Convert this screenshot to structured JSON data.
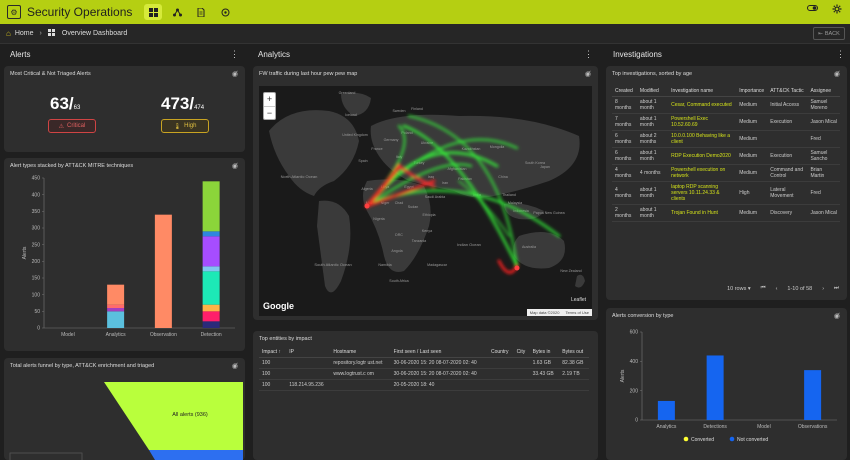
{
  "app": {
    "title": "Security Operations"
  },
  "breadcrumb": {
    "home": "Home",
    "current": "Overview Dashboard",
    "back": "BACK"
  },
  "columns": {
    "alerts": "Alerts",
    "analytics": "Analytics",
    "investigations": "Investigations"
  },
  "critical_card": {
    "title": "Most Critical & Not Triaged Alerts",
    "critical": {
      "value": "63/",
      "total": "63",
      "label": "Critical"
    },
    "high": {
      "value": "473/",
      "total": "474",
      "label": "High"
    }
  },
  "mitre_card": {
    "title": "Alert types stacked by ATT&CK MITRE techniques"
  },
  "funnel_card": {
    "title": "Total alerts funnel by type, ATT&CK enrichment and triaged",
    "label": "All alerts (936)"
  },
  "map_card": {
    "title": "FW traffic during last hour pew pew map",
    "zoom_in": "+",
    "zoom_out": "−",
    "google": "Google",
    "leaflet": "Leaflet",
    "map_data": "Map data ©2020",
    "terms": "Terms of Use",
    "labels": [
      {
        "t": "Greenland"
      },
      {
        "t": "Iceland"
      },
      {
        "t": "Sweden"
      },
      {
        "t": "Finland"
      },
      {
        "t": "United Kingdom"
      },
      {
        "t": "Poland"
      },
      {
        "t": "Germany"
      },
      {
        "t": "Ukraine"
      },
      {
        "t": "France"
      },
      {
        "t": "Spain"
      },
      {
        "t": "Italy"
      },
      {
        "t": "Turkey"
      },
      {
        "t": "Kazakhstan"
      },
      {
        "t": "Mongolia"
      },
      {
        "t": "China"
      },
      {
        "t": "Japan"
      },
      {
        "t": "South Korea"
      },
      {
        "t": "Afghanistan"
      },
      {
        "t": "Pakistan"
      },
      {
        "t": "Iran"
      },
      {
        "t": "Iraq"
      },
      {
        "t": "Egypt"
      },
      {
        "t": "Libya"
      },
      {
        "t": "Algeria"
      },
      {
        "t": "Mali"
      },
      {
        "t": "Niger"
      },
      {
        "t": "Chad"
      },
      {
        "t": "Sudan"
      },
      {
        "t": "Nigeria"
      },
      {
        "t": "Ethiopia"
      },
      {
        "t": "Saudi Arabia"
      },
      {
        "t": "India"
      },
      {
        "t": "Thailand"
      },
      {
        "t": "Kenya"
      },
      {
        "t": "DRC"
      },
      {
        "t": "Tanzania"
      },
      {
        "t": "Angola"
      },
      {
        "t": "Namibia"
      },
      {
        "t": "Madagascar"
      },
      {
        "t": "South Africa"
      },
      {
        "t": "Indonesia"
      },
      {
        "t": "Papua New Guinea"
      },
      {
        "t": "Australia"
      },
      {
        "t": "New Zealand"
      },
      {
        "t": "North Atlantic Ocean"
      },
      {
        "t": "South Atlantic Ocean"
      },
      {
        "t": "Indian Ocean"
      },
      {
        "t": "Malaysia"
      }
    ]
  },
  "entities_card": {
    "title": "Top entities by impact",
    "headers": [
      "Impact ↑",
      "IP",
      "Hostname",
      "First seen / Last seen",
      "Country",
      "City",
      "Bytes in",
      "Bytes out"
    ],
    "rows": [
      [
        "100",
        "",
        "repository.logtr ust.net",
        "30-06-2020 15: 20 08-07-2020 02: 40",
        "",
        "",
        "1.63 GB",
        "82.38 GB"
      ],
      [
        "100",
        "",
        "www.logtrust.c om",
        "30-06-2020 15: 20 08-07-2020 02: 40",
        "",
        "",
        "33.43 GB",
        "2.19 TB"
      ],
      [
        "100",
        "118.214.95.236",
        "",
        "20-05-2020 18: 40",
        "",
        "",
        "",
        ""
      ]
    ]
  },
  "investigations_card": {
    "title": "Top investigations, sorted by age",
    "headers": [
      "Created",
      "Modified",
      "Investigation name",
      "Importance",
      "ATT&CK Tactic",
      "Assignee"
    ],
    "rows": [
      [
        "8 months",
        "about 1 month",
        "Cesar, Command executed",
        "Medium",
        "Initial Access",
        "Samuel Moreno"
      ],
      [
        "7 months",
        "about 1 month",
        "Powershell Exec 10.52.60.69",
        "Medium",
        "Execution",
        "Jason Mical"
      ],
      [
        "6 months",
        "about 2 months",
        "10.0.0.100 Behaving like a client",
        "Medium",
        "",
        "Fred"
      ],
      [
        "6 months",
        "about 1 month",
        "RDP Execution Demo2020",
        "Medium",
        "Execution",
        "Samuel Sancho"
      ],
      [
        "4 months",
        "4 months",
        "Powershell execution on network",
        "Medium",
        "Command and Control",
        "Brian Martin"
      ],
      [
        "4 months",
        "about 1 month",
        "laptop RDP scanning servers 10.11.24.33 & clients",
        "High",
        "Lateral Movement",
        "Fred"
      ],
      [
        "2 months",
        "about 1 month",
        "Trojan Found in Hunt",
        "Medium",
        "Discovery",
        "Jason Mical"
      ]
    ],
    "pagination": {
      "rows": "10 rows",
      "range": "1-10 of 58"
    }
  },
  "mitre_chart": {
    "chart_data": {
      "type": "bar",
      "stacked": true,
      "categories": [
        "Model",
        "Analytics",
        "Observation",
        "Detection"
      ],
      "ylabel": "Alerts",
      "ylim": [
        0,
        450
      ],
      "yticks": [
        0,
        50,
        100,
        150,
        200,
        250,
        300,
        350,
        400,
        450
      ],
      "stacks": [
        [],
        [
          {
            "v": 50,
            "c": "#5bc0de"
          },
          {
            "v": 10,
            "c": "#a33fbf"
          },
          {
            "v": 10,
            "c": "#ff6b6b"
          },
          {
            "v": 60,
            "c": "#ff8a65"
          }
        ],
        [
          {
            "v": 340,
            "c": "#ff8a65"
          }
        ],
        [
          {
            "v": 20,
            "c": "#2a2a7a"
          },
          {
            "v": 30,
            "c": "#ff1f6a"
          },
          {
            "v": 20,
            "c": "#ffb347"
          },
          {
            "v": 100,
            "c": "#1de9b6"
          },
          {
            "v": 15,
            "c": "#7fc6f0"
          },
          {
            "v": 90,
            "c": "#a64dff"
          },
          {
            "v": 15,
            "c": "#2e86de"
          },
          {
            "v": 150,
            "c": "#8bd53a"
          }
        ]
      ]
    }
  },
  "conversion_chart": {
    "title": "Alerts conversion by type",
    "chart_data": {
      "type": "bar",
      "categories": [
        "Analytics",
        "Detections",
        "Model",
        "Observations"
      ],
      "series": [
        {
          "name": "Converted",
          "values": [
            0,
            0,
            0,
            0
          ],
          "color": "#ffff33"
        },
        {
          "name": "Not converted",
          "values": [
            130,
            440,
            0,
            340
          ],
          "color": "#1565f0"
        }
      ],
      "ylabel": "Alerts",
      "ylim": [
        0,
        600
      ],
      "yticks": [
        0,
        200,
        400,
        600
      ],
      "legend": "bottom"
    }
  }
}
